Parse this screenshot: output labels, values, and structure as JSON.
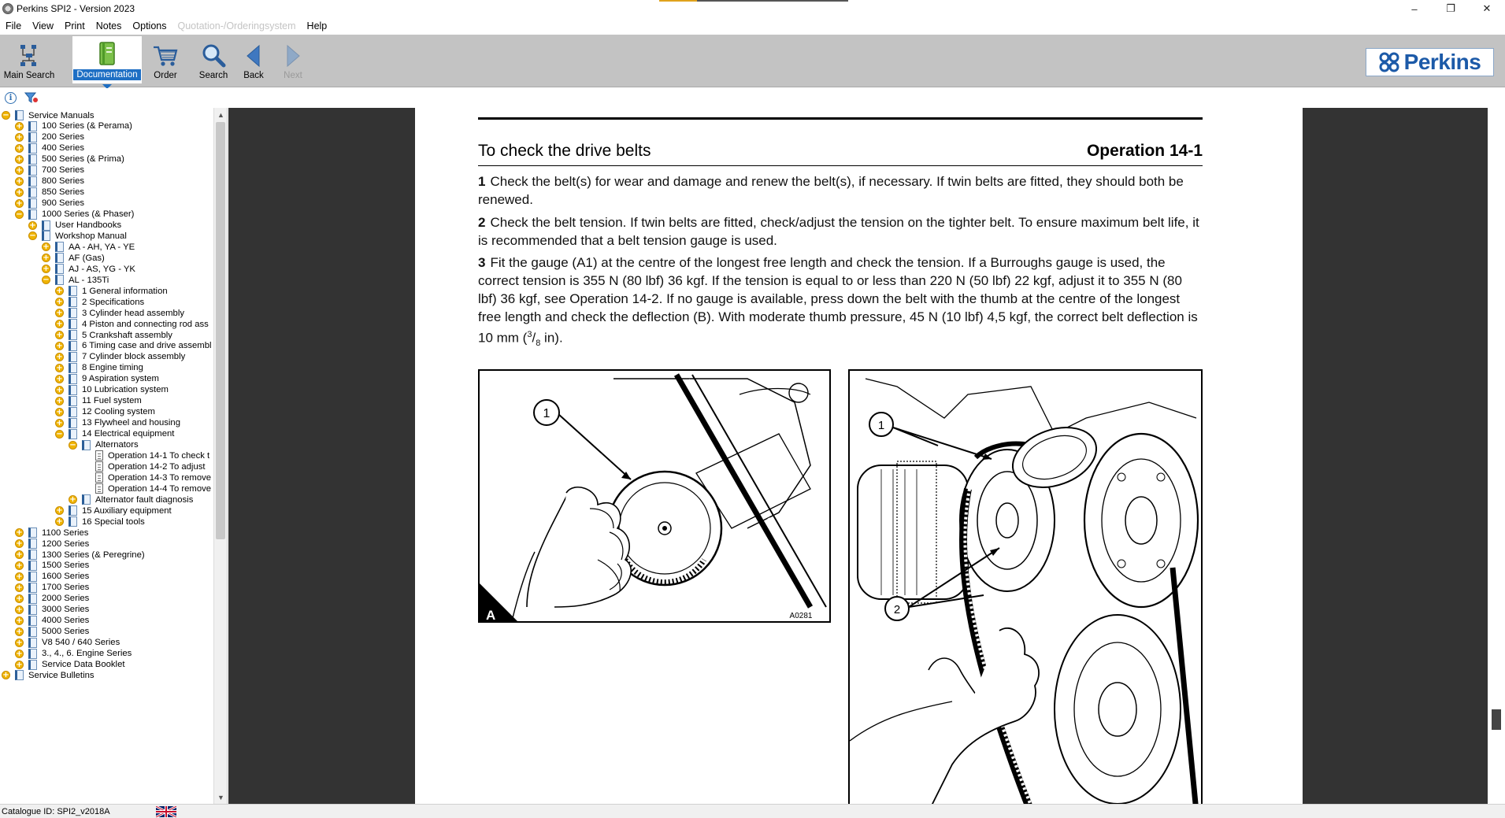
{
  "window": {
    "title": "Perkins SPI2 - Version 2023",
    "controls": [
      "–",
      "❐",
      "✕"
    ]
  },
  "menu": [
    {
      "label": "File",
      "enabled": true
    },
    {
      "label": "View",
      "enabled": true
    },
    {
      "label": "Print",
      "enabled": true
    },
    {
      "label": "Notes",
      "enabled": true
    },
    {
      "label": "Options",
      "enabled": true
    },
    {
      "label": "Quotation-/Orderingsystem",
      "enabled": false
    },
    {
      "label": "Help",
      "enabled": true
    }
  ],
  "toolbar": {
    "main_search": "Main Search",
    "documentation": "Documentation",
    "order": "Order",
    "search": "Search",
    "back": "Back",
    "next": "Next",
    "active": "Documentation",
    "accent_color": "#1e6fc4",
    "logo_text": "Perkins"
  },
  "tree": {
    "items": [
      {
        "label": "Service Manuals",
        "level": 0,
        "toggle": "−",
        "icon": "book"
      },
      {
        "label": "100 Series (& Perama)",
        "level": 1,
        "toggle": "+",
        "icon": "book"
      },
      {
        "label": "200 Series",
        "level": 1,
        "toggle": "+",
        "icon": "book"
      },
      {
        "label": "400 Series",
        "level": 1,
        "toggle": "+",
        "icon": "book"
      },
      {
        "label": "500 Series (& Prima)",
        "level": 1,
        "toggle": "+",
        "icon": "book"
      },
      {
        "label": "700 Series",
        "level": 1,
        "toggle": "+",
        "icon": "book"
      },
      {
        "label": "800 Series",
        "level": 1,
        "toggle": "+",
        "icon": "book"
      },
      {
        "label": "850 Series",
        "level": 1,
        "toggle": "+",
        "icon": "book"
      },
      {
        "label": "900 Series",
        "level": 1,
        "toggle": "+",
        "icon": "book"
      },
      {
        "label": "1000 Series (& Phaser)",
        "level": 1,
        "toggle": "−",
        "icon": "book"
      },
      {
        "label": "User Handbooks",
        "level": 2,
        "toggle": "+",
        "icon": "book"
      },
      {
        "label": "Workshop Manual",
        "level": 2,
        "toggle": "−",
        "icon": "book"
      },
      {
        "label": "AA - AH, YA - YE",
        "level": 3,
        "toggle": "+",
        "icon": "book"
      },
      {
        "label": "AF (Gas)",
        "level": 3,
        "toggle": "+",
        "icon": "book"
      },
      {
        "label": "AJ - AS, YG - YK",
        "level": 3,
        "toggle": "+",
        "icon": "book"
      },
      {
        "label": "AL - 135Ti",
        "level": 3,
        "toggle": "−",
        "icon": "book"
      },
      {
        "label": "1 General information",
        "level": 4,
        "toggle": "+",
        "icon": "book"
      },
      {
        "label": "2 Specifications",
        "level": 4,
        "toggle": "+",
        "icon": "book"
      },
      {
        "label": "3 Cylinder head assembly",
        "level": 4,
        "toggle": "+",
        "icon": "book"
      },
      {
        "label": "4 Piston and connecting rod ass",
        "level": 4,
        "toggle": "+",
        "icon": "book"
      },
      {
        "label": "5 Crankshaft assembly",
        "level": 4,
        "toggle": "+",
        "icon": "book"
      },
      {
        "label": "6 Timing case and drive assembl",
        "level": 4,
        "toggle": "+",
        "icon": "book"
      },
      {
        "label": "7 Cylinder block assembly",
        "level": 4,
        "toggle": "+",
        "icon": "book"
      },
      {
        "label": "8 Engine timing",
        "level": 4,
        "toggle": "+",
        "icon": "book"
      },
      {
        "label": "9 Aspiration system",
        "level": 4,
        "toggle": "+",
        "icon": "book"
      },
      {
        "label": "10 Lubrication system",
        "level": 4,
        "toggle": "+",
        "icon": "book"
      },
      {
        "label": "11 Fuel system",
        "level": 4,
        "toggle": "+",
        "icon": "book"
      },
      {
        "label": "12 Cooling system",
        "level": 4,
        "toggle": "+",
        "icon": "book"
      },
      {
        "label": "13 Flywheel and housing",
        "level": 4,
        "toggle": "+",
        "icon": "book"
      },
      {
        "label": "14 Electrical equipment",
        "level": 4,
        "toggle": "−",
        "icon": "book"
      },
      {
        "label": "Alternators",
        "level": 5,
        "toggle": "−",
        "icon": "book"
      },
      {
        "label": "Operation 14-1 To check t",
        "level": 6,
        "toggle": "",
        "icon": "page"
      },
      {
        "label": "Operation 14-2 To adjust",
        "level": 6,
        "toggle": "",
        "icon": "page"
      },
      {
        "label": "Operation 14-3 To remove",
        "level": 6,
        "toggle": "",
        "icon": "page"
      },
      {
        "label": "Operation 14-4 To remove",
        "level": 6,
        "toggle": "",
        "icon": "page"
      },
      {
        "label": "Alternator fault diagnosis",
        "level": 5,
        "toggle": "+",
        "icon": "book"
      },
      {
        "label": "15 Auxiliary equipment",
        "level": 4,
        "toggle": "+",
        "icon": "book"
      },
      {
        "label": "16 Special tools",
        "level": 4,
        "toggle": "+",
        "icon": "book"
      },
      {
        "label": "1100 Series",
        "level": 1,
        "toggle": "+",
        "icon": "book"
      },
      {
        "label": "1200 Series",
        "level": 1,
        "toggle": "+",
        "icon": "book"
      },
      {
        "label": "1300 Series (& Peregrine)",
        "level": 1,
        "toggle": "+",
        "icon": "book"
      },
      {
        "label": "1500 Series",
        "level": 1,
        "toggle": "+",
        "icon": "book"
      },
      {
        "label": "1600 Series",
        "level": 1,
        "toggle": "+",
        "icon": "book"
      },
      {
        "label": "1700 Series",
        "level": 1,
        "toggle": "+",
        "icon": "book"
      },
      {
        "label": "2000 Series",
        "level": 1,
        "toggle": "+",
        "icon": "book"
      },
      {
        "label": "3000 Series",
        "level": 1,
        "toggle": "+",
        "icon": "book"
      },
      {
        "label": "4000 Series",
        "level": 1,
        "toggle": "+",
        "icon": "book"
      },
      {
        "label": "5000 Series",
        "level": 1,
        "toggle": "+",
        "icon": "book"
      },
      {
        "label": "V8 540 / 640 Series",
        "level": 1,
        "toggle": "+",
        "icon": "book"
      },
      {
        "label": "3., 4., 6. Engine Series",
        "level": 1,
        "toggle": "+",
        "icon": "book"
      },
      {
        "label": "Service Data Booklet",
        "level": 1,
        "toggle": "+",
        "icon": "book"
      },
      {
        "label": "Service Bulletins",
        "level": 0,
        "toggle": "+",
        "icon": "book"
      }
    ]
  },
  "document": {
    "section_title": "To check the drive belts",
    "operation": "Operation 14-1",
    "steps": [
      {
        "num": "1",
        "text": "Check the belt(s) for wear and damage and renew the belt(s), if necessary. If twin belts are fitted, they should both be renewed."
      },
      {
        "num": "2",
        "text": "Check the belt tension. If twin belts are fitted, check/adjust the tension on the tighter belt. To ensure maximum belt life, it is recommended that a belt tension gauge is used."
      },
      {
        "num": "3",
        "text_before": "Fit the gauge (A1) at the centre of the longest free length and check the tension. If a Burroughs gauge is used, the correct tension is 355 N (80 lbf) 36 kgf. If the tension is equal to or less than 220 N (50 lbf) 22 kgf, adjust it to 355 N (80 lbf) 36 kgf, see Operation 14-2. If no gauge is available, press down the belt with the thumb at the centre of the longest free length and check the deflection (B). With moderate thumb pressure, 45 N (10 lbf) 4,5 kgf, the correct belt deflection is 10 mm (",
        "frac_num": "3",
        "frac_den": "8",
        "text_after": " in)."
      }
    ],
    "figure_a": {
      "callout": "1",
      "corner_label": "A",
      "code": "A0281"
    },
    "figure_b": {
      "callout_1": "1",
      "callout_2": "2"
    }
  },
  "status": {
    "catalogue": "Catalogue ID: SPI2_v2018A",
    "language_flag": "uk-flag-icon"
  }
}
